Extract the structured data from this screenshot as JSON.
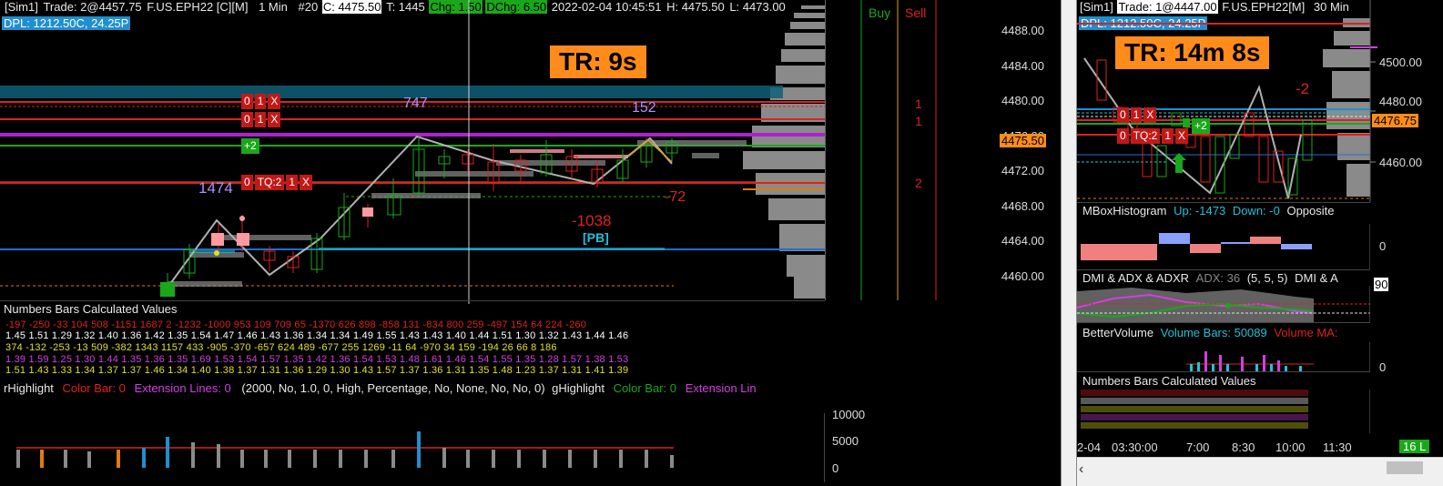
{
  "left": {
    "header": {
      "account": "[Sim1]",
      "trade": "Trade: 2@4457.75",
      "instrument": "F.US.EPH22 [C][M]",
      "interval": "1 Min",
      "bar": "#20",
      "close": "C: 4475.50",
      "ticks": "T: 1445",
      "chg": "Chg: 1.50",
      "dchg": "DChg: 6.50",
      "datetime": "2022-02-04 10:45:51",
      "high": "H: 4475.50",
      "low": "L: 4473.00"
    },
    "dpl": "DPL: 1212.50C, 24.25P",
    "tr": "TR: 9s",
    "labels": {
      "v747": "747",
      "v152": "152",
      "v1474": "1474",
      "v72": "-72",
      "v1038": "-1038",
      "pb": "[PB]",
      "plus2": "+2"
    },
    "orders": [
      [
        "0",
        "1",
        "X"
      ],
      [
        "0",
        "1",
        "X"
      ],
      [
        "0",
        "TQ:2",
        "1",
        "X"
      ]
    ],
    "buy": "Buy",
    "sell": "Sell",
    "sell_counts": [
      "1",
      "1",
      "2"
    ],
    "prices": [
      "4488.00",
      "4484.00",
      "4480.00",
      "4476.00",
      "4472.00",
      "4468.00",
      "4464.00",
      "4460.00"
    ],
    "current_price": "4475.50",
    "numbers_title": "Numbers Bars Calculated Values",
    "numbers_rows": [
      "-197 -250  -33   104  508 -1151 1687   2  -1232 -1000  953   109   709    65  -1370  626   898  -858  131  -834  800   259  -497   154    64   224  -260",
      "1.45  1.51  1.29  1.32  1.40  1.36  1.42  1.35  1.54  1.47  1.46  1.43  1.36  1.34  1.34  1.49  1.55  1.43  1.43  1.40  1.44  1.51  1.30  1.32  1.43  1.44  1.46",
      "374  -132 -253  -13   509  -382 1343 1157  433  -905  -370  -657  624   489  -677  255  1269   -11    64  -970   34   159  -194    26    66     8   186",
      "1.39  1.59  1.25  1.30  1.44  1.35  1.36  1.35  1.69  1.53  1.54  1.57  1.35  1.42  1.36  1.54  1.53  1.48  1.61  1.46  1.54  1.55  1.35  1.28  1.57  1.38  1.53",
      "1.51  1.43  1.33  1.34  1.37  1.37  1.46  1.34  1.40  1.38  1.37  1.31  1.36  1.29  1.30  1.43  1.57  1.37  1.36  1.31  1.35  1.48  1.23  1.37  1.31  1.41  1.39"
    ],
    "highlight": {
      "name": "rHighlight",
      "color_bar": "Color Bar: 0",
      "ext_lines": "Extension Lines: 0",
      "params": "(2000, No, 1.0, 0, High, Percentage, No, None, No, No, 0)",
      "g_name": "gHighlight",
      "g_color_bar": "Color Bar: 0",
      "g_ext": "Extension Lin"
    },
    "vol_axis": [
      "10000",
      "5000",
      "0"
    ]
  },
  "right": {
    "header": {
      "account": "[Sim1]",
      "trade": "Trade: 1@4447.00",
      "instrument": "F.US.EPH22[M]",
      "interval": "30 Min"
    },
    "dpl": "DPL: 1212.50C, 24.25P",
    "tr": "TR: 14m 8s",
    "labels": {
      "neg2": "-2",
      "plus2": "+2"
    },
    "orders": [
      [
        "0",
        "1",
        "X"
      ],
      [
        "0",
        "TQ:2",
        "1",
        "X"
      ]
    ],
    "prices": [
      "4500.00",
      "4480.00",
      "4460.00"
    ],
    "current_price": "4476.75",
    "mbox": {
      "title": "MBoxHistogram",
      "up": "Up: -1473",
      "down": "Down: -0",
      "opp": "Opposite",
      "axis": "0"
    },
    "dmi": {
      "title": "DMI & ADX & ADXR",
      "adx": "ADX: 36",
      "params": "(5, 5, 5)",
      "more": "DMI & A",
      "axis": "90"
    },
    "better": {
      "title": "BetterVolume",
      "bars": "Volume Bars: 50089",
      "ma": "Volume MA:",
      "axis": "0"
    },
    "numbers_title": "Numbers Bars Calculated Values",
    "time_axis": [
      "2-04",
      "03:30:00",
      "7:00",
      "8:30",
      "10:00",
      "11:30"
    ],
    "status": "16 L"
  },
  "colors": {
    "up": "#1aa81a",
    "down": "#e02020",
    "orange": "#ff8c1a",
    "purple": "#b060ff",
    "cyan": "#22c0d8",
    "magenta": "#d040e0"
  }
}
